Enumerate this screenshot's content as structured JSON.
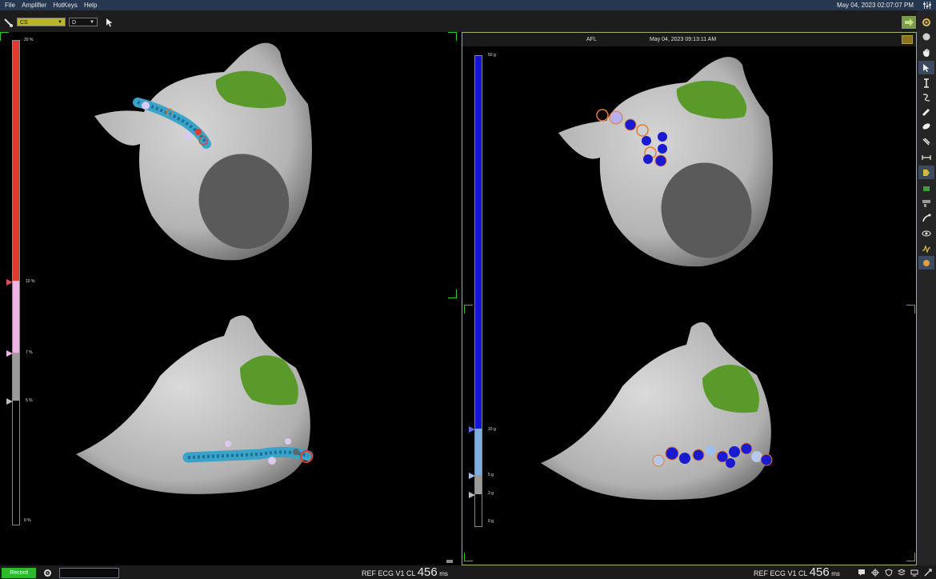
{
  "menu": {
    "items": [
      "File",
      "Amplifier",
      "HotKeys",
      "Help"
    ],
    "clock": "May 04, 2023 02:07:07 PM"
  },
  "toolbar": {
    "catheter": "CS",
    "mode": "D"
  },
  "left_view": {
    "scale": {
      "labels": [
        "20 %",
        "10 %",
        "7 %",
        "5 %",
        "0 %"
      ],
      "red_color": "#e23a2c",
      "pink_color": "#efb3e6",
      "gray_color": "#9b9b9b"
    }
  },
  "right_view": {
    "header": {
      "name": "AFL",
      "timestamp": "May 04, 2023 09:13:11 AM"
    },
    "scale": {
      "labels": [
        "50 g",
        "10 g",
        "5 g",
        "3 g",
        "0 g"
      ],
      "blue_color": "#1414d8",
      "light_blue_color": "#7aaee8",
      "gray_color": "#9b9b9b"
    }
  },
  "status": {
    "record_label": "Record",
    "cl_label": "REF ECG V1 CL",
    "cl_value": "456",
    "cl_unit": "ms"
  },
  "sidebar_icons": [
    "settings-icon",
    "sphere-icon",
    "hand-icon",
    "pointer-icon",
    "caliper-icon",
    "curve-icon",
    "pencil-icon",
    "eraser-icon",
    "slash-icon",
    "measure-icon",
    "label-icon",
    "surface-icon",
    "layers-icon",
    "catheter-icon",
    "visibility-icon",
    "signal-icon",
    "lesion-icon"
  ],
  "colors": {
    "accent_green": "#28c828",
    "heart_gray": "#c9c9c9",
    "appendage_green": "#5a9a2a",
    "lesion_teal": "#3aa3c8",
    "lesion_blue": "#1a1ad0"
  }
}
